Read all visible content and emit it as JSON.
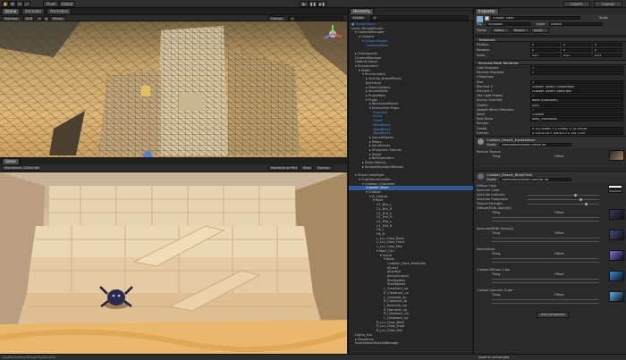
{
  "toolbar": {
    "tools": [
      "✋",
      "✥",
      "⟳",
      "⤢"
    ],
    "pivot": "Pivot",
    "global": "Global",
    "play_icons": [
      "▶",
      "❚❚",
      "▶❚"
    ],
    "layers": "Layers",
    "layout": "Layout"
  },
  "scene_tabs": {
    "scene": "Scene",
    "animator": "Animator",
    "animation": "Animation"
  },
  "scene_bar": {
    "mode": "Textured",
    "rgb": "RGB",
    "lighting": "☀",
    "audio": "◖",
    "fx": "Effects",
    "gizmos": "Gizmos",
    "search": "All"
  },
  "game_tab": {
    "label": "Game",
    "aspect": "Standalone (1024x768)",
    "maximize": "Maximize on Play",
    "stats": "Stats",
    "gizmos": "Gizmos"
  },
  "hierarchy": {
    "tab": "Hierarchy",
    "create": "Create",
    "search": "All",
    "rows": [
      {
        "t": "■ GameObject",
        "d": 0,
        "c": "blue"
      },
      {
        "t": "Level_TemplePuzzle",
        "d": 0
      },
      {
        "t": "▾ CameraManager",
        "d": 1
      },
      {
        "t": "▾ Camera",
        "d": 2
      },
      {
        "t": "▾ CameraTarget",
        "d": 3,
        "c": "blue"
      },
      {
        "t": "CameraOffset",
        "d": 4,
        "c": "blue"
      },
      {
        "t": "",
        "d": 0
      },
      {
        "t": "▸ Checkpoints",
        "d": 1
      },
      {
        "t": "CinemaManager",
        "d": 1
      },
      {
        "t": "Default Arena",
        "d": 1
      },
      {
        "t": "▾ Environment",
        "d": 1
      },
      {
        "t": "▾ Static",
        "d": 2
      },
      {
        "t": "▾ Environment",
        "d": 3
      },
      {
        "t": "▸ Vicinity_ArenaPieces",
        "d": 4
      },
      {
        "t": "Backdrop",
        "d": 4
      },
      {
        "t": "▸ FloorColliders",
        "d": 4
      },
      {
        "t": "▸ AccessWalls",
        "d": 4
      },
      {
        "t": "▸ PropsWalls",
        "d": 4
      },
      {
        "t": "▾ Props",
        "d": 4
      },
      {
        "t": "▸ BlocksAndRocks",
        "d": 5
      },
      {
        "t": "▾ Interactive Props",
        "d": 5
      },
      {
        "t": "Pushable",
        "d": 6,
        "c": "blue"
      },
      {
        "t": "Chest",
        "d": 6,
        "c": "blue"
      },
      {
        "t": "Chest",
        "d": 6,
        "c": "blue"
      },
      {
        "t": "WoodBlock",
        "d": 6,
        "c": "blue"
      },
      {
        "t": "WoodBlock",
        "d": 6,
        "c": "blue"
      },
      {
        "t": "WoodBlock",
        "d": 6,
        "c": "blue"
      },
      {
        "t": "▸ SacredBlocks",
        "d": 5
      },
      {
        "t": "▸ Pillars",
        "d": 5
      },
      {
        "t": "▸ SandDunes",
        "d": 5
      },
      {
        "t": "▸ Shipwreck Sounds",
        "d": 5
      },
      {
        "t": "▸ Stone",
        "d": 5
      },
      {
        "t": "▸ BellOperators",
        "d": 5
      },
      {
        "t": "▸ StaticObjects",
        "d": 3
      },
      {
        "t": "▸ SimpleBlocksAndRamps",
        "d": 3
      },
      {
        "t": "",
        "d": 0
      },
      {
        "t": "▾ StoneCrabsFight",
        "d": 1
      },
      {
        "t": "▾ CrabStoneHandler",
        "d": 2
      },
      {
        "t": "▾ Crabber_Character",
        "d": 3
      },
      {
        "t": "Crabber_Mesh",
        "d": 4,
        "c": "sel"
      },
      {
        "t": "▾ Crabber",
        "d": 4
      },
      {
        "t": "▾ Jt_Control",
        "d": 5
      },
      {
        "t": "▾ Root",
        "d": 6
      },
      {
        "t": "C1_Bck_L",
        "d": 7
      },
      {
        "t": "C1_Bck_R",
        "d": 7
      },
      {
        "t": "C1_Frnt_L",
        "d": 7
      },
      {
        "t": "C1_Frnt_R",
        "d": 7
      },
      {
        "t": "C1_Mid_L",
        "d": 7
      },
      {
        "t": "C1_Mid_R",
        "d": 7
      },
      {
        "t": "Hk_L",
        "d": 7
      },
      {
        "t": "Hk_R",
        "d": 7
      },
      {
        "t": "L_Lcc_Claw_Back",
        "d": 7
      },
      {
        "t": "L_Lcc_Claw_Front",
        "d": 7
      },
      {
        "t": "L_Lcc_Claw_Mid",
        "d": 7
      },
      {
        "t": "▾ Main_Ctrl",
        "d": 7
      },
      {
        "t": "▾ Spine",
        "d": 8
      },
      {
        "t": "▾ Body",
        "d": 9
      },
      {
        "t": "Crabber_Dark_Markpike",
        "d": 10
      },
      {
        "t": "pEyeLf",
        "d": 10
      },
      {
        "t": "pEyeRgt",
        "d": 10
      },
      {
        "t": "pelvisGround",
        "d": 10
      },
      {
        "t": "Shellspikes",
        "d": 10
      },
      {
        "t": "ShellSpikes",
        "d": 10
      },
      {
        "t": "L_Clawfront_up",
        "d": 9
      },
      {
        "t": "R_Clawfront_up",
        "d": 9
      },
      {
        "t": "L_Clawmid_up",
        "d": 9
      },
      {
        "t": "R_Clawmid_up",
        "d": 9
      },
      {
        "t": "L_Hammer_up",
        "d": 9
      },
      {
        "t": "R_Hammer_up",
        "d": 9
      },
      {
        "t": "R_Clawback_up",
        "d": 9
      },
      {
        "t": "L_Clawback_up",
        "d": 9
      },
      {
        "t": "R_Lcc_Claw_Back",
        "d": 7
      },
      {
        "t": "R_Lcc_Claw_Front",
        "d": 7
      },
      {
        "t": "R_Lcc_Claw_Mid",
        "d": 7
      },
      {
        "t": "Lights_Env",
        "d": 1
      },
      {
        "t": "▸ Sequence",
        "d": 1
      },
      {
        "t": "InteractiveObjectsManager",
        "d": 1
      }
    ]
  },
  "inspector": {
    "tab": "Inspector",
    "object_name": "Crabber_Mesh",
    "static": "Static",
    "tag_label": "Tag",
    "tag_value": "Untagged",
    "layer_label": "Layer",
    "layer_value": "Default",
    "prefab_label": "Prefab",
    "prefab_select": "Select",
    "prefab_revert": "Revert",
    "prefab_apply": "Apply",
    "transform": {
      "title": "Transform",
      "position": {
        "label": "Position",
        "x": "0",
        "y": "0",
        "z": "0"
      },
      "rotation": {
        "label": "Rotation",
        "x": "0",
        "y": "0",
        "z": "0"
      },
      "scale": {
        "label": "Scale",
        "x": "0.01",
        "y": "0.01",
        "z": "0.01"
      }
    },
    "smr": {
      "title": "Skinned Mesh Renderer",
      "rows": [
        {
          "label": "Cast Shadows",
          "value": "✓"
        },
        {
          "label": "Receive Shadows",
          "value": "✓"
        },
        {
          "label": "▾ Materials",
          "value": ""
        },
        {
          "label": "Size",
          "value": "2"
        },
        {
          "label": "Element 0",
          "value": "Crabber_Desert_Exoskeleton"
        },
        {
          "label": "Element 1",
          "value": "Crabber_Desert_BodyFlesh"
        },
        {
          "label": "Use Light Probes",
          "value": "✓"
        },
        {
          "label": "Anchor Override",
          "value": "None (Transform)"
        },
        {
          "label": "Quality",
          "value": "Auto"
        },
        {
          "label": "Update When Offscreen",
          "value": "✓"
        },
        {
          "label": "Mesh",
          "value": "Crabber"
        },
        {
          "label": "Root Bone",
          "value": "Body_Translation"
        },
        {
          "label": "Bounds",
          "value": ""
        },
        {
          "label": "Center",
          "value": "X 102.80063   Y 2.139667   Z 10.95546"
        },
        {
          "label": "Extents",
          "value": "X 326.8716   Y 106.8713   Z 191.7244"
        }
      ]
    },
    "mat1": {
      "title": "Crabber_Desert_Exoskeleton",
      "shader_label": "Shader",
      "shader": "Marmoset/Bumped Diffuse IBL",
      "row_label": "Particle Texture",
      "tiling": "Tiling",
      "offset": "Offset"
    },
    "mat2": {
      "title": "Crabber_Desert_BodyFlesh",
      "shader_label": "Shader",
      "shader": "Marmoset/Bumped Specular IBL",
      "rows": [
        "Diffuse Color",
        "Specular Color",
        "Specular Intensity",
        "Specular Sharpness",
        "Fresnel Strength",
        "Diffuse(RGB) Alpha(A)",
        "Specular(RGB) Gloss(A)",
        "Normalmap",
        "Custom Diffuse Cube",
        "Custom Specular Cube"
      ],
      "tiling": "Tiling",
      "offset": "Offset"
    },
    "add_component": "Add Component"
  },
  "status": {
    "left": "Assets/Scenes/TemplePuzzle.unity",
    "right": "Asset is unchanged"
  }
}
